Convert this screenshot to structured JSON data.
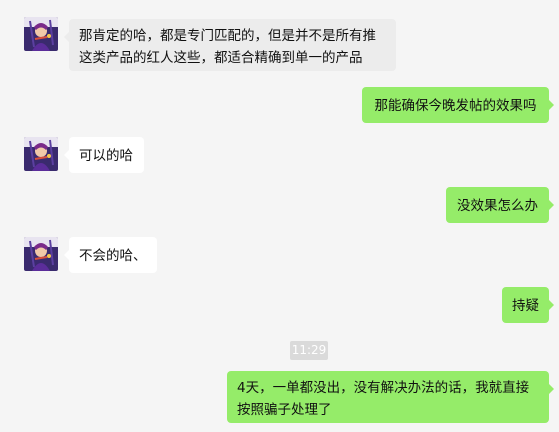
{
  "colors": {
    "background": "#f5f5f5",
    "incoming_bubble": "#ffffff",
    "incoming_bubble_first": "#ececec",
    "outgoing_bubble": "#95ec69",
    "time_chip": "#dadada"
  },
  "messages": [
    {
      "direction": "incoming",
      "lines": [
        "那肯定的哈，都是专门匹配的，但是并不是所有推",
        "这类产品的红人这些，都适合精确到单一的产品"
      ]
    },
    {
      "direction": "outgoing",
      "text": "那能确保今晚发帖的效果吗"
    },
    {
      "direction": "incoming",
      "text": "可以的哈"
    },
    {
      "direction": "outgoing",
      "text": "没效果怎么办"
    },
    {
      "direction": "incoming",
      "text": "不会的哈、"
    },
    {
      "direction": "outgoing",
      "text": "持疑"
    },
    {
      "direction": "outgoing",
      "lines": [
        "4天，一单都没出，没有解决办法的话，我就直接",
        "按照骗子处理了"
      ]
    }
  ],
  "timestamp": "11:29",
  "avatar_icon": "anime-character-avatar-icon"
}
